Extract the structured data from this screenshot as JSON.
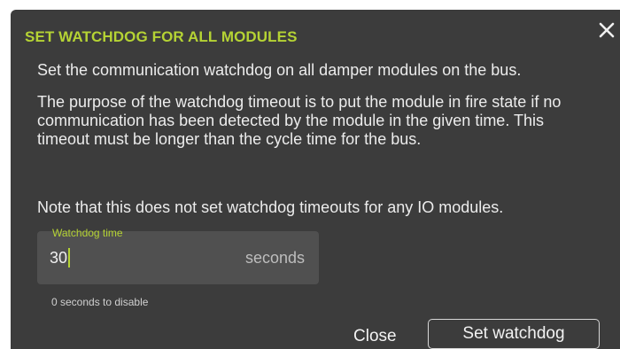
{
  "dialog": {
    "title": "SET WATCHDOG FOR ALL MODULES",
    "paragraph1": "Set the communication watchdog on all damper modules on the bus.",
    "paragraph2": "The purpose of the watchdog timeout is to put the module in fire state if no communication has been detected by the module in the given time. This timeout must be longer than the cycle time for the bus.",
    "paragraph3": "Note that this does not set watchdog timeouts for any IO modules.",
    "field": {
      "label": "Watchdog time",
      "value": "30",
      "suffix": "seconds",
      "hint": "0 seconds to disable"
    },
    "buttons": {
      "close": "Close",
      "set": "Set watchdog"
    },
    "icons": {
      "close": "close-icon"
    }
  },
  "colors": {
    "accent": "#b5d334",
    "dialog_bg": "#3c3c3c",
    "field_bg": "#505050"
  }
}
